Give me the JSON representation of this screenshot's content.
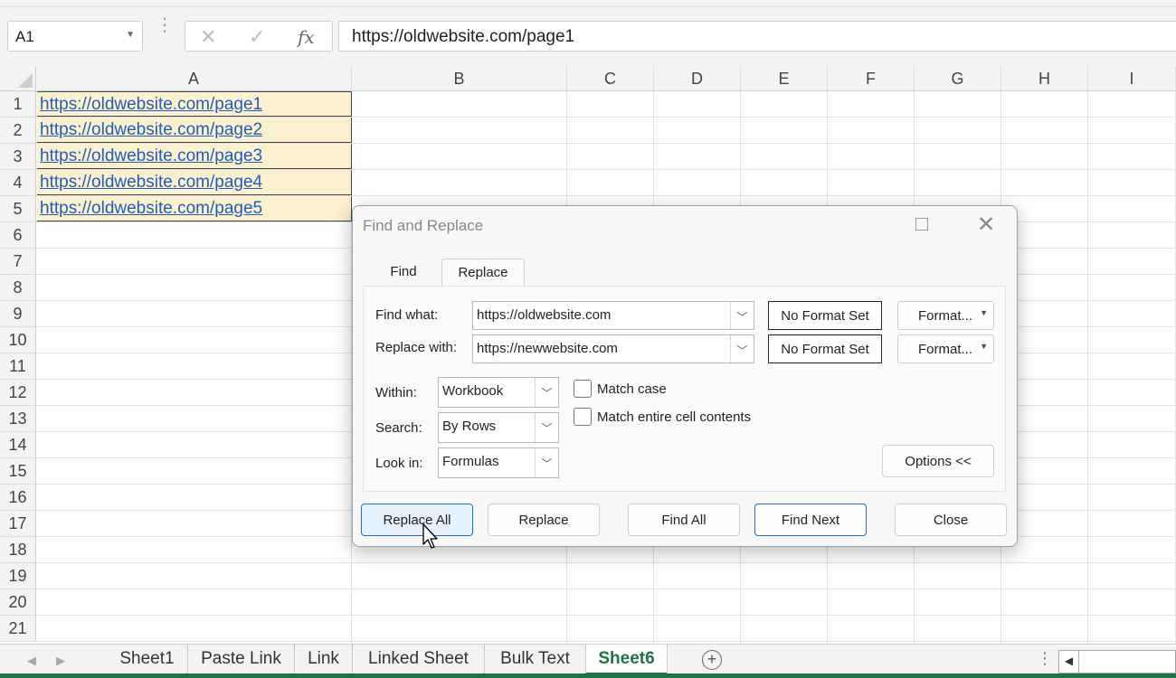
{
  "formula_bar": {
    "name_box": "A1",
    "dots": "⋮",
    "cancel_icon": "✕",
    "enter_icon": "✓",
    "fx_label": "fx",
    "content": "https://oldwebsite.com/page1"
  },
  "grid": {
    "columns": [
      "A",
      "B",
      "C",
      "D",
      "E",
      "F",
      "G",
      "H",
      "I"
    ],
    "rows": [
      "1",
      "2",
      "3",
      "4",
      "5",
      "6",
      "7",
      "8",
      "9",
      "10",
      "11",
      "12",
      "13",
      "14",
      "15",
      "16",
      "17",
      "18",
      "19",
      "20",
      "21"
    ],
    "cells_a": [
      "https://oldwebsite.com/page1",
      "https://oldwebsite.com/page2",
      "https://oldwebsite.com/page3",
      "https://oldwebsite.com/page4",
      "https://oldwebsite.com/page5"
    ],
    "link_color": "#1f5fb8",
    "fill_color": "#fbf0cf"
  },
  "sheet_tabs": {
    "tabs": [
      "Sheet1",
      "Paste Link",
      "Link",
      "Linked Sheet",
      "Bulk Text",
      "Sheet6"
    ],
    "active": "Sheet6",
    "add_icon": "+",
    "nav_left": "◀",
    "nav_right": "▶",
    "accent": "#217346"
  },
  "dialog": {
    "title": "Find and Replace",
    "tabs": {
      "find": "Find",
      "replace": "Replace"
    },
    "find_what_label": "Find what:",
    "find_what_value": "https://oldwebsite.com",
    "replace_with_label": "Replace with:",
    "replace_with_value": "https://newwebsite.com",
    "no_format_set": "No Format Set",
    "format_button": "Format...",
    "within_label": "Within:",
    "within_value": "Workbook",
    "search_label": "Search:",
    "search_value": "By Rows",
    "look_in_label": "Look in:",
    "look_in_value": "Formulas",
    "match_case": "Match case",
    "match_entire": "Match entire cell contents",
    "options_button": "Options <<",
    "buttons": {
      "replace_all": "Replace All",
      "replace": "Replace",
      "find_all": "Find All",
      "find_next": "Find Next",
      "close": "Close"
    }
  }
}
